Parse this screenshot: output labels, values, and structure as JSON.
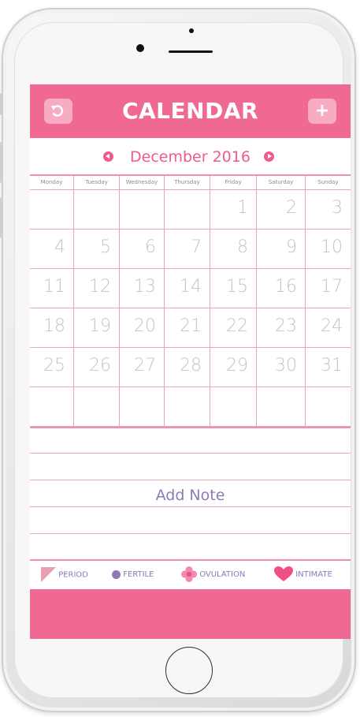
{
  "header": {
    "title": "CALENDAR",
    "back_icon": "undo-icon",
    "add_label": "+"
  },
  "month": {
    "label": "December 2016"
  },
  "weekdays": [
    "Monday",
    "Tuesday",
    "Wednesday",
    "Thursday",
    "Friday",
    "Saturday",
    "Sunday"
  ],
  "weeks": [
    [
      "",
      "",
      "",
      "",
      "1",
      "2",
      "3"
    ],
    [
      "4",
      "5",
      "6",
      "7",
      "8",
      "9",
      "10"
    ],
    [
      "11",
      "12",
      "13",
      "14",
      "15",
      "16",
      "17"
    ],
    [
      "18",
      "19",
      "20",
      "21",
      "22",
      "23",
      "24"
    ],
    [
      "25",
      "26",
      "27",
      "28",
      "29",
      "30",
      "31"
    ],
    [
      "",
      "",
      "",
      "",
      "",
      "",
      ""
    ]
  ],
  "notes": {
    "add_note_label": "Add Note"
  },
  "legend": {
    "period": "PERIOD",
    "fertile": "FERTILE",
    "ovulation": "OVULATION",
    "intimate": "INTIMATE"
  },
  "colors": {
    "brand_pink": "#f06993",
    "accent_pink": "#ef5b8c",
    "grid_line": "#e8a7be",
    "purple": "#8d7ab6",
    "day_text": "#c4c4c4"
  }
}
